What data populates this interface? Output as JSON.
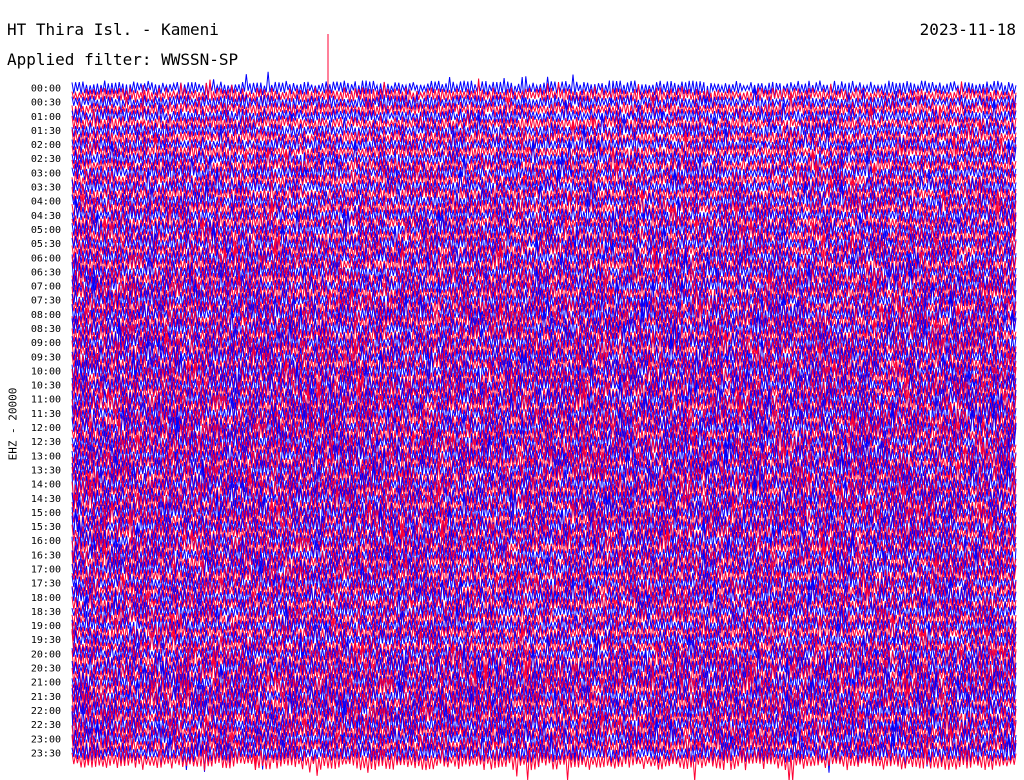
{
  "header": {
    "station": "HT Thira Isl. - Kameni",
    "date": "2023-11-18",
    "filter_label": "Applied filter: WWSSN-SP"
  },
  "channel_label": "EHZ - 20000",
  "colors": {
    "trace_a": "#0000ff",
    "trace_b": "#ff0033",
    "background": "#ffffff",
    "text": "#000000"
  },
  "chart_data": {
    "type": "line",
    "title": "HT Thira Isl. - Kameni",
    "ylabel": "EHZ - 20000",
    "row_interval_minutes": 15,
    "time_labels": [
      "00:00",
      "00:30",
      "01:00",
      "01:30",
      "02:00",
      "02:30",
      "03:00",
      "03:30",
      "04:00",
      "04:30",
      "05:00",
      "05:30",
      "06:00",
      "06:30",
      "07:00",
      "07:30",
      "08:00",
      "08:30",
      "09:00",
      "09:30",
      "10:00",
      "10:30",
      "11:00",
      "11:30",
      "12:00",
      "12:30",
      "13:00",
      "13:30",
      "14:00",
      "14:30",
      "15:00",
      "15:30",
      "16:00",
      "16:30",
      "17:00",
      "17:30",
      "18:00",
      "18:30",
      "19:00",
      "19:30",
      "20:00",
      "20:30",
      "21:00",
      "21:30",
      "22:00",
      "22:30",
      "23:00",
      "23:30"
    ],
    "row_count": 96,
    "series_colors": [
      "#0000ff",
      "#ff0033"
    ],
    "grid": false
  }
}
